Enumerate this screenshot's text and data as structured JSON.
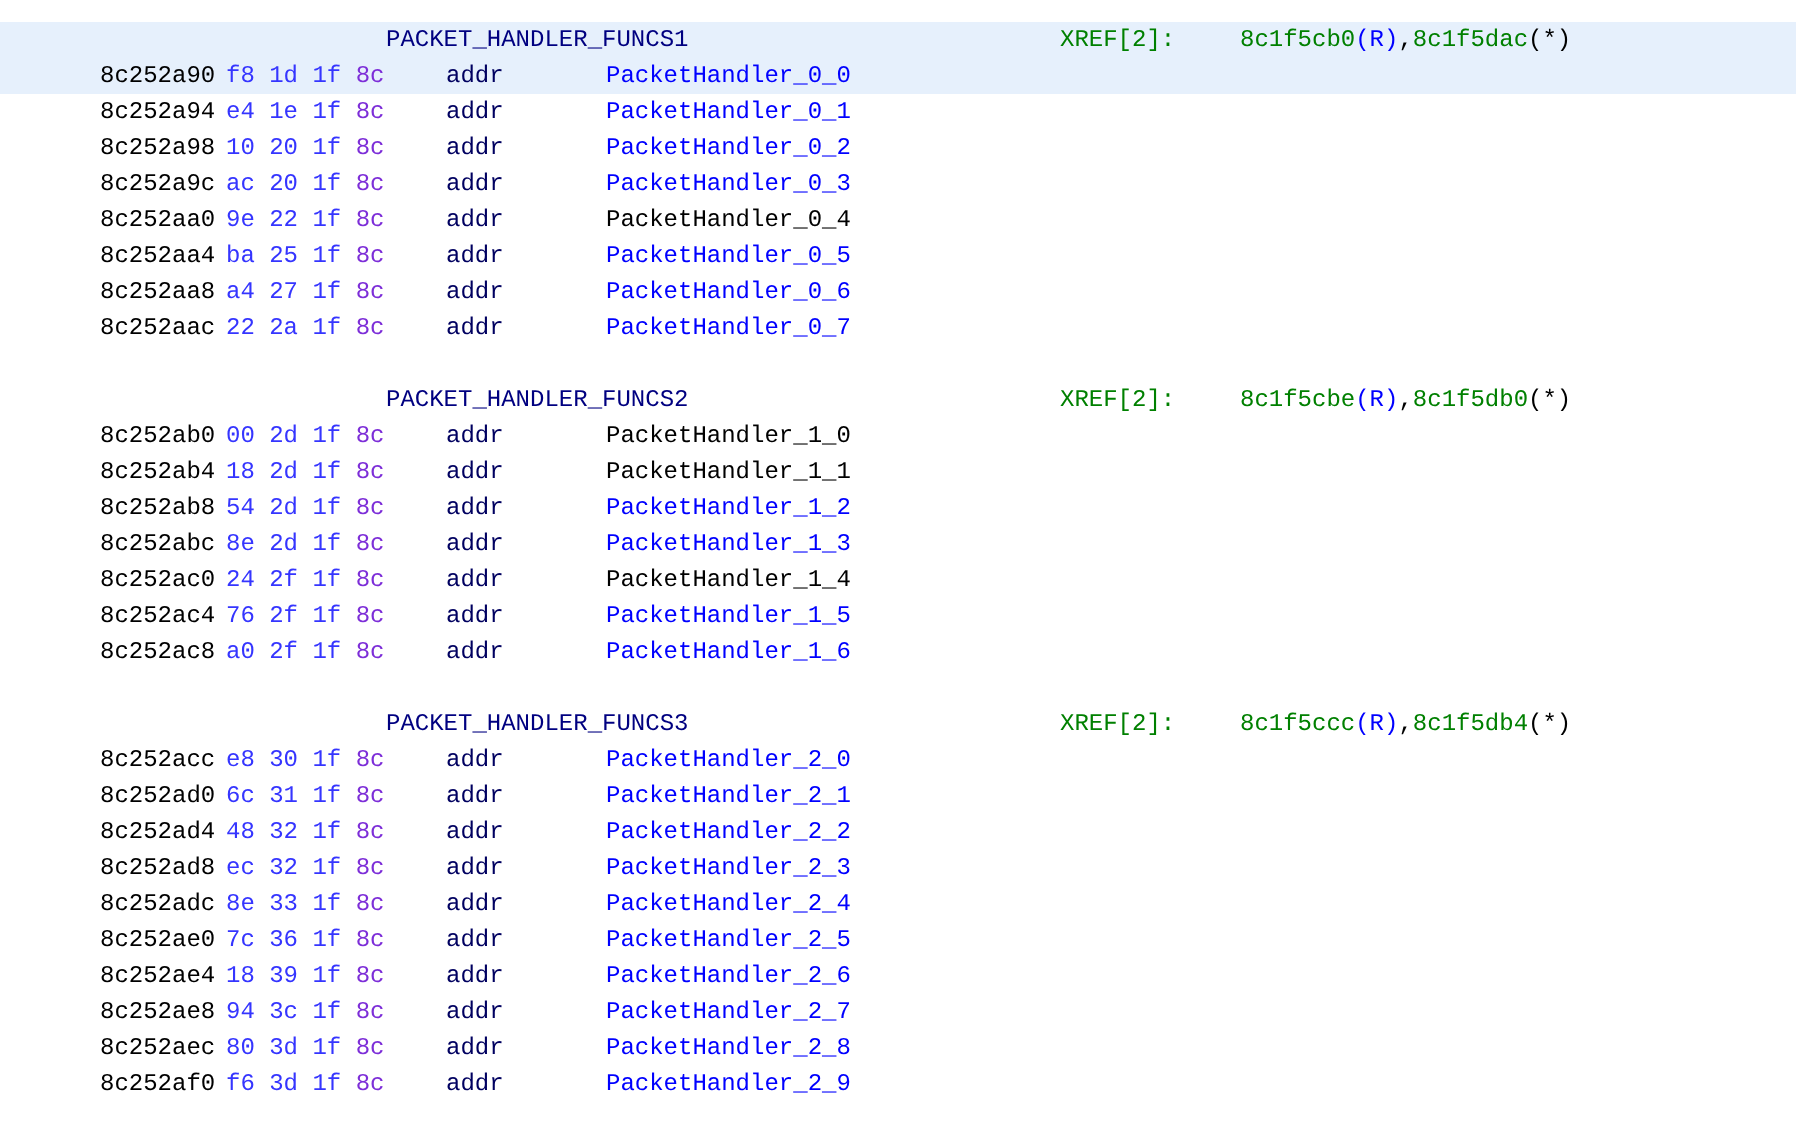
{
  "blocks": [
    {
      "label": "PACKET_HANDLER_FUNCS1",
      "selected": true,
      "xref": {
        "label": "XREF[2]:",
        "separator": ",",
        "refs": [
          {
            "address": "8c1f5cb0",
            "access": "(R)",
            "kind": "read"
          },
          {
            "address": "8c1f5dac",
            "access": "(*)",
            "kind": "pointer"
          }
        ]
      },
      "rows": [
        {
          "address": "8c252a90",
          "bytes": [
            "f8",
            "1d",
            "1f",
            "8c"
          ],
          "mnemonic": "addr",
          "operand": "PacketHandler_0_0",
          "resolved": true
        },
        {
          "address": "8c252a94",
          "bytes": [
            "e4",
            "1e",
            "1f",
            "8c"
          ],
          "mnemonic": "addr",
          "operand": "PacketHandler_0_1",
          "resolved": true
        },
        {
          "address": "8c252a98",
          "bytes": [
            "10",
            "20",
            "1f",
            "8c"
          ],
          "mnemonic": "addr",
          "operand": "PacketHandler_0_2",
          "resolved": true
        },
        {
          "address": "8c252a9c",
          "bytes": [
            "ac",
            "20",
            "1f",
            "8c"
          ],
          "mnemonic": "addr",
          "operand": "PacketHandler_0_3",
          "resolved": true
        },
        {
          "address": "8c252aa0",
          "bytes": [
            "9e",
            "22",
            "1f",
            "8c"
          ],
          "mnemonic": "addr",
          "operand": "PacketHandler_0_4",
          "resolved": false
        },
        {
          "address": "8c252aa4",
          "bytes": [
            "ba",
            "25",
            "1f",
            "8c"
          ],
          "mnemonic": "addr",
          "operand": "PacketHandler_0_5",
          "resolved": true
        },
        {
          "address": "8c252aa8",
          "bytes": [
            "a4",
            "27",
            "1f",
            "8c"
          ],
          "mnemonic": "addr",
          "operand": "PacketHandler_0_6",
          "resolved": true
        },
        {
          "address": "8c252aac",
          "bytes": [
            "22",
            "2a",
            "1f",
            "8c"
          ],
          "mnemonic": "addr",
          "operand": "PacketHandler_0_7",
          "resolved": true
        }
      ]
    },
    {
      "label": "PACKET_HANDLER_FUNCS2",
      "selected": false,
      "xref": {
        "label": "XREF[2]:",
        "separator": ",",
        "refs": [
          {
            "address": "8c1f5cbe",
            "access": "(R)",
            "kind": "read"
          },
          {
            "address": "8c1f5db0",
            "access": "(*)",
            "kind": "pointer"
          }
        ]
      },
      "rows": [
        {
          "address": "8c252ab0",
          "bytes": [
            "00",
            "2d",
            "1f",
            "8c"
          ],
          "mnemonic": "addr",
          "operand": "PacketHandler_1_0",
          "resolved": false
        },
        {
          "address": "8c252ab4",
          "bytes": [
            "18",
            "2d",
            "1f",
            "8c"
          ],
          "mnemonic": "addr",
          "operand": "PacketHandler_1_1",
          "resolved": false
        },
        {
          "address": "8c252ab8",
          "bytes": [
            "54",
            "2d",
            "1f",
            "8c"
          ],
          "mnemonic": "addr",
          "operand": "PacketHandler_1_2",
          "resolved": true
        },
        {
          "address": "8c252abc",
          "bytes": [
            "8e",
            "2d",
            "1f",
            "8c"
          ],
          "mnemonic": "addr",
          "operand": "PacketHandler_1_3",
          "resolved": true
        },
        {
          "address": "8c252ac0",
          "bytes": [
            "24",
            "2f",
            "1f",
            "8c"
          ],
          "mnemonic": "addr",
          "operand": "PacketHandler_1_4",
          "resolved": false
        },
        {
          "address": "8c252ac4",
          "bytes": [
            "76",
            "2f",
            "1f",
            "8c"
          ],
          "mnemonic": "addr",
          "operand": "PacketHandler_1_5",
          "resolved": true
        },
        {
          "address": "8c252ac8",
          "bytes": [
            "a0",
            "2f",
            "1f",
            "8c"
          ],
          "mnemonic": "addr",
          "operand": "PacketHandler_1_6",
          "resolved": true
        }
      ]
    },
    {
      "label": "PACKET_HANDLER_FUNCS3",
      "selected": false,
      "xref": {
        "label": "XREF[2]:",
        "separator": ",",
        "refs": [
          {
            "address": "8c1f5ccc",
            "access": "(R)",
            "kind": "read"
          },
          {
            "address": "8c1f5db4",
            "access": "(*)",
            "kind": "pointer"
          }
        ]
      },
      "rows": [
        {
          "address": "8c252acc",
          "bytes": [
            "e8",
            "30",
            "1f",
            "8c"
          ],
          "mnemonic": "addr",
          "operand": "PacketHandler_2_0",
          "resolved": true
        },
        {
          "address": "8c252ad0",
          "bytes": [
            "6c",
            "31",
            "1f",
            "8c"
          ],
          "mnemonic": "addr",
          "operand": "PacketHandler_2_1",
          "resolved": true
        },
        {
          "address": "8c252ad4",
          "bytes": [
            "48",
            "32",
            "1f",
            "8c"
          ],
          "mnemonic": "addr",
          "operand": "PacketHandler_2_2",
          "resolved": true
        },
        {
          "address": "8c252ad8",
          "bytes": [
            "ec",
            "32",
            "1f",
            "8c"
          ],
          "mnemonic": "addr",
          "operand": "PacketHandler_2_3",
          "resolved": true
        },
        {
          "address": "8c252adc",
          "bytes": [
            "8e",
            "33",
            "1f",
            "8c"
          ],
          "mnemonic": "addr",
          "operand": "PacketHandler_2_4",
          "resolved": true
        },
        {
          "address": "8c252ae0",
          "bytes": [
            "7c",
            "36",
            "1f",
            "8c"
          ],
          "mnemonic": "addr",
          "operand": "PacketHandler_2_5",
          "resolved": true
        },
        {
          "address": "8c252ae4",
          "bytes": [
            "18",
            "39",
            "1f",
            "8c"
          ],
          "mnemonic": "addr",
          "operand": "PacketHandler_2_6",
          "resolved": true
        },
        {
          "address": "8c252ae8",
          "bytes": [
            "94",
            "3c",
            "1f",
            "8c"
          ],
          "mnemonic": "addr",
          "operand": "PacketHandler_2_7",
          "resolved": true
        },
        {
          "address": "8c252aec",
          "bytes": [
            "80",
            "3d",
            "1f",
            "8c"
          ],
          "mnemonic": "addr",
          "operand": "PacketHandler_2_8",
          "resolved": true
        },
        {
          "address": "8c252af0",
          "bytes": [
            "f6",
            "3d",
            "1f",
            "8c"
          ],
          "mnemonic": "addr",
          "operand": "PacketHandler_2_9",
          "resolved": true
        }
      ]
    }
  ]
}
